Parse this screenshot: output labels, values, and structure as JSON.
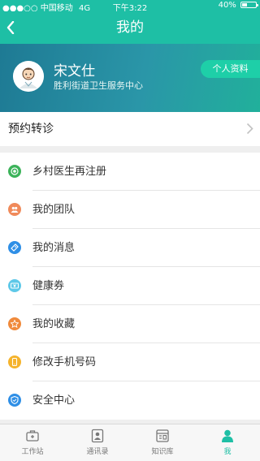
{
  "status_bar": {
    "carrier": "●●●○○ 中国移动",
    "network": "4G",
    "time": "下午3:22",
    "battery": "40%",
    "battery_level": 0.4
  },
  "nav": {
    "title": "我的",
    "back_icon": "back-arrow-icon"
  },
  "profile": {
    "name": "宋文仕",
    "organization": "胜利街道卫生服务中心",
    "button_label": "个人资料"
  },
  "referral": {
    "label": "预约转诊"
  },
  "menu": {
    "items": [
      {
        "label": "乡村医生再注册",
        "icon": "target-icon",
        "color": "#3cb35a"
      },
      {
        "label": "我的团队",
        "icon": "team-icon",
        "color": "#f08a5a"
      },
      {
        "label": "我的消息",
        "icon": "message-icon",
        "color": "#2f8fe6"
      },
      {
        "label": "健康券",
        "icon": "coupon-icon",
        "color": "#5ec8e8"
      },
      {
        "label": "我的收藏",
        "icon": "star-icon",
        "color": "#f08a3c"
      },
      {
        "label": "修改手机号码",
        "icon": "phone-icon",
        "color": "#f5b32c"
      },
      {
        "label": "安全中心",
        "icon": "shield-icon",
        "color": "#2f8fe6"
      }
    ]
  },
  "tabs": [
    {
      "label": "工作站",
      "icon": "toolbox-icon",
      "active": false
    },
    {
      "label": "通讯录",
      "icon": "contacts-icon",
      "active": false
    },
    {
      "label": "知识库",
      "icon": "knowledge-icon",
      "active": false
    },
    {
      "label": "我",
      "icon": "person-icon",
      "active": true
    }
  ],
  "colors": {
    "primary": "#1ebfa5",
    "active_tab": "#1ebfa5"
  }
}
